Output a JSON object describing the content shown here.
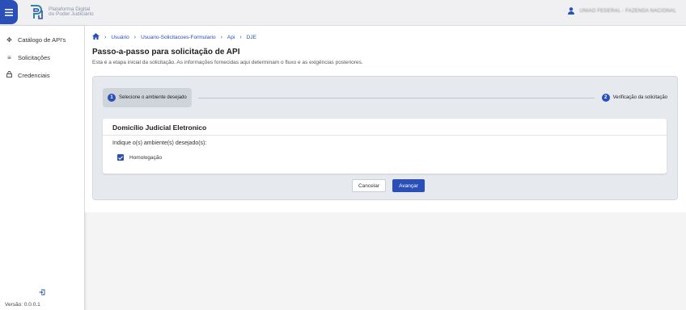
{
  "header": {
    "logo_text": "Plataforma Digital do Poder Judiciário",
    "user_name": "UNIÃO FEDERAL - FAZENDA NACIONAL"
  },
  "sidebar": {
    "items": [
      {
        "label": "Catálogo de API's",
        "icon": "diamond-nodes-icon"
      },
      {
        "label": "Solicitações",
        "icon": "list-check-icon"
      },
      {
        "label": "Credenciais",
        "icon": "lock-icon"
      }
    ],
    "version": "Versão: 0.0.0.1"
  },
  "breadcrumb": {
    "items": [
      "Usuário",
      "Usuario-Solicitacoes-Formulario",
      "Api",
      "DJE"
    ]
  },
  "page": {
    "title": "Passo-a-passo para solicitação de API",
    "subtitle": "Esta é a etapa inicial da solicitação. As informações fornecidas aqui determinam o fluxo e as exigências posteriores."
  },
  "stepper": {
    "step1_num": "1",
    "step1_label": "Selecione o ambiente desejado",
    "step2_num": "2",
    "step2_label": "Verificação da solicitação"
  },
  "form": {
    "title": "Domicílio Judicial Eletronico",
    "prompt": "Indique o(s) ambiente(s) desejado(s):",
    "option_label": "Homologação",
    "option_checked": true
  },
  "actions": {
    "cancel_label": "Cancelar",
    "next_label": "Avançar"
  },
  "colors": {
    "accent": "#2a4fb7"
  }
}
